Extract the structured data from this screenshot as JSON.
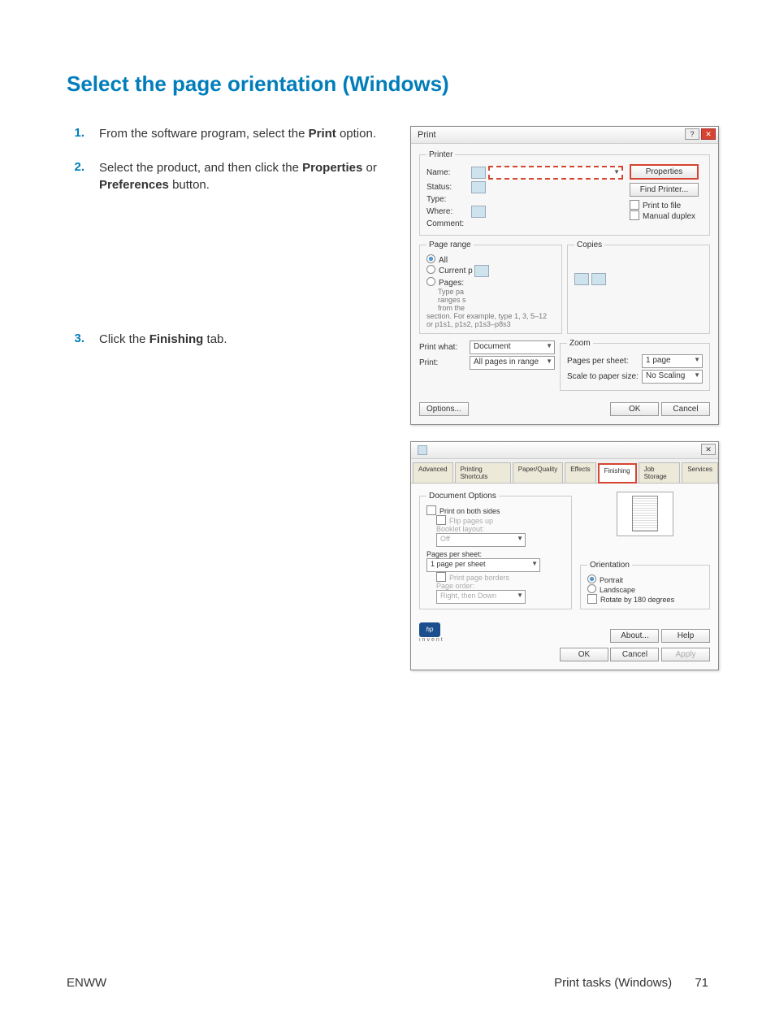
{
  "heading": "Select the page orientation (Windows)",
  "steps": {
    "s1": {
      "num": "1.",
      "preText": "From the software program, select the ",
      "bold1": "Print",
      "postText": " option."
    },
    "s2": {
      "num": "2.",
      "preText": "Select the product, and then click the ",
      "bold1": "Properties",
      "mid": " or ",
      "bold2": "Preferences",
      "postText": " button."
    },
    "s3": {
      "num": "3.",
      "preText": "Click the ",
      "bold1": "Finishing",
      "postText": " tab."
    }
  },
  "dlg1": {
    "title": "Print",
    "printer_legend": "Printer",
    "name": "Name:",
    "status": "Status:",
    "type": "Type:",
    "where": "Where:",
    "comment": "Comment:",
    "properties_btn": "Properties",
    "find_printer_btn": "Find Printer...",
    "print_to_file": "Print to file",
    "manual_duplex": "Manual duplex",
    "page_range_legend": "Page range",
    "all": "All",
    "current": "Current p",
    "pages": "Pages:",
    "typepa": "Type pa",
    "rangess": "ranges s",
    "fromthe": "from the",
    "range_hint": "section. For example, type 1, 3, 5–12 or p1s1, p1s2, p1s3–p8s3",
    "copies_legend": "Copies",
    "print_what_l": "Print what:",
    "print_what_v": "Document",
    "print_l": "Print:",
    "print_v": "All pages in range",
    "zoom_legend": "Zoom",
    "pps_l": "Pages per sheet:",
    "pps_v": "1 page",
    "scale_l": "Scale to paper size:",
    "scale_v": "No Scaling",
    "options_btn": "Options...",
    "ok_btn": "OK",
    "cancel_btn": "Cancel"
  },
  "dlg2": {
    "tabs": {
      "advanced": "Advanced",
      "shortcuts": "Printing Shortcuts",
      "paper": "Paper/Quality",
      "effects": "Effects",
      "finishing": "Finishing",
      "job": "Job Storage",
      "services": "Services"
    },
    "doc_options": "Document Options",
    "print_both": "Print on both sides",
    "flip_up": "Flip pages up",
    "booklet": "Booklet layout:",
    "booklet_v": "Off",
    "pps_l": "Pages per sheet:",
    "pps_v": "1 page per sheet",
    "borders": "Print page borders",
    "order_l": "Page order:",
    "order_v": "Right, then Down",
    "orientation": "Orientation",
    "portrait": "Portrait",
    "landscape": "Landscape",
    "rotate": "Rotate by 180 degrees",
    "about": "About...",
    "help": "Help",
    "ok": "OK",
    "cancel": "Cancel",
    "apply": "Apply",
    "hp": "hp",
    "invent": "invent"
  },
  "footer": {
    "left": "ENWW",
    "right_text": "Print tasks (Windows)",
    "page": "71"
  }
}
